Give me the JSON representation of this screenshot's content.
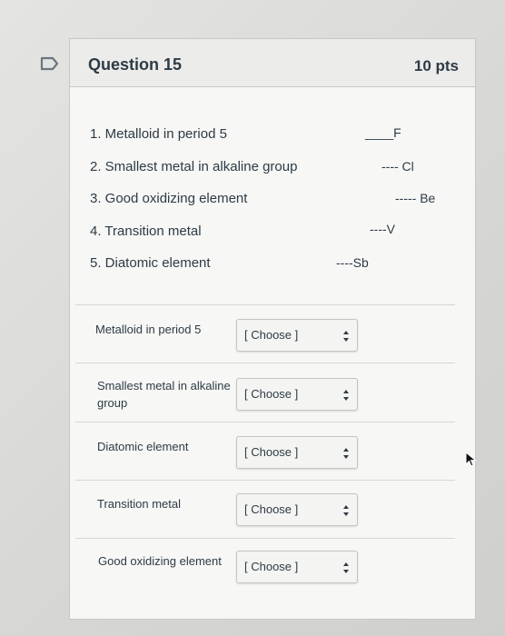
{
  "question": {
    "title": "Question 15",
    "points": "10 pts"
  },
  "prompt_items": [
    "1. Metalloid in period 5",
    "2. Smallest metal in alkaline group",
    "3. Good oxidizing element",
    "4. Transition metal",
    "5. Diatomic element"
  ],
  "answer_notes": [
    "____F",
    "---- Cl",
    "----- Be",
    "----V",
    "----Sb"
  ],
  "matches": [
    {
      "label": "Metalloid in period  5",
      "select": "[ Choose ]"
    },
    {
      "label": "Smallest metal in alkaline group",
      "select": "[ Choose ]"
    },
    {
      "label": "Diatomic  element",
      "select": "[ Choose ]"
    },
    {
      "label": "Transition metal",
      "select": "[ Choose ]"
    },
    {
      "label": "Good oxidizing element",
      "select": "[ Choose ]"
    }
  ],
  "icons": {
    "flag": "bookmark-flag-icon",
    "select_arrows": "up-down-arrows-icon",
    "cursor": "mouse-pointer-icon"
  },
  "colors": {
    "text": "#2d3b45",
    "header_bg": "#ececea",
    "card_bg": "#f7f7f5"
  }
}
